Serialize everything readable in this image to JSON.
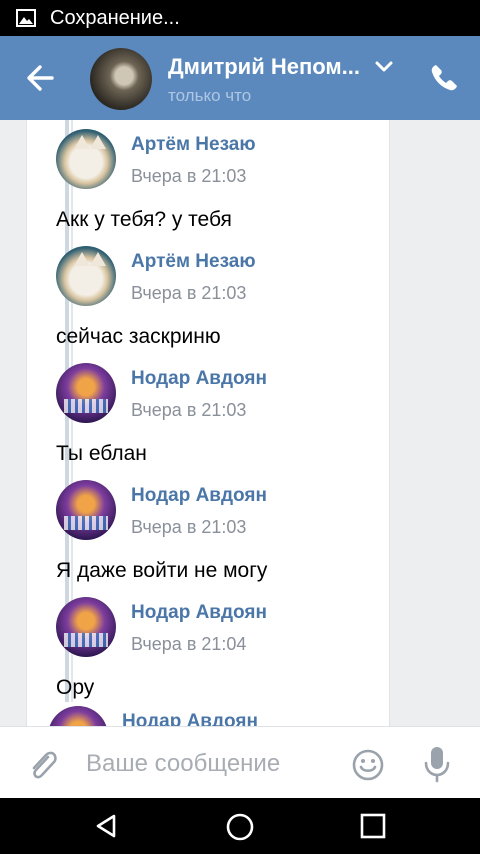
{
  "status_bar": {
    "icon": "image-icon",
    "text": "Сохранение..."
  },
  "header": {
    "title": "Дмитрий Непом...",
    "subtitle": "только что",
    "back_icon": "arrow-left-icon",
    "dropdown_icon": "chevron-down-icon",
    "call_icon": "phone-icon"
  },
  "messages": [
    {
      "author": "Артём Незаю",
      "time": "Вчера в 21:03",
      "text": "Акк у тебя? у тебя",
      "avatar": "cat"
    },
    {
      "author": "Артём Незаю",
      "time": "Вчера в 21:03",
      "text": "сейчас заскриню",
      "avatar": "cat"
    },
    {
      "author": "Нодар Авдоян",
      "time": "Вчера в 21:03",
      "text": "Ты еблан",
      "avatar": "poster"
    },
    {
      "author": "Нодар Авдоян",
      "time": "Вчера в 21:03",
      "text": "Я даже войти не могу",
      "avatar": "poster"
    },
    {
      "author": "Нодар Авдоян",
      "time": "Вчера в 21:04",
      "text": "Ору",
      "avatar": "poster"
    },
    {
      "author": "Нодар Авдоян",
      "time": "",
      "text": "",
      "avatar": "poster"
    }
  ],
  "composer": {
    "placeholder": "Ваше сообщение",
    "attach_icon": "paperclip-icon",
    "emoji_icon": "smile-icon",
    "mic_icon": "microphone-icon"
  },
  "nav_bar": {
    "back": "triangle-back-icon",
    "home": "circle-home-icon",
    "recents": "square-recents-icon"
  },
  "colors": {
    "header": "#5b88bd",
    "link": "#4a76a8",
    "time": "#8a9099",
    "background": "#edeef0"
  }
}
